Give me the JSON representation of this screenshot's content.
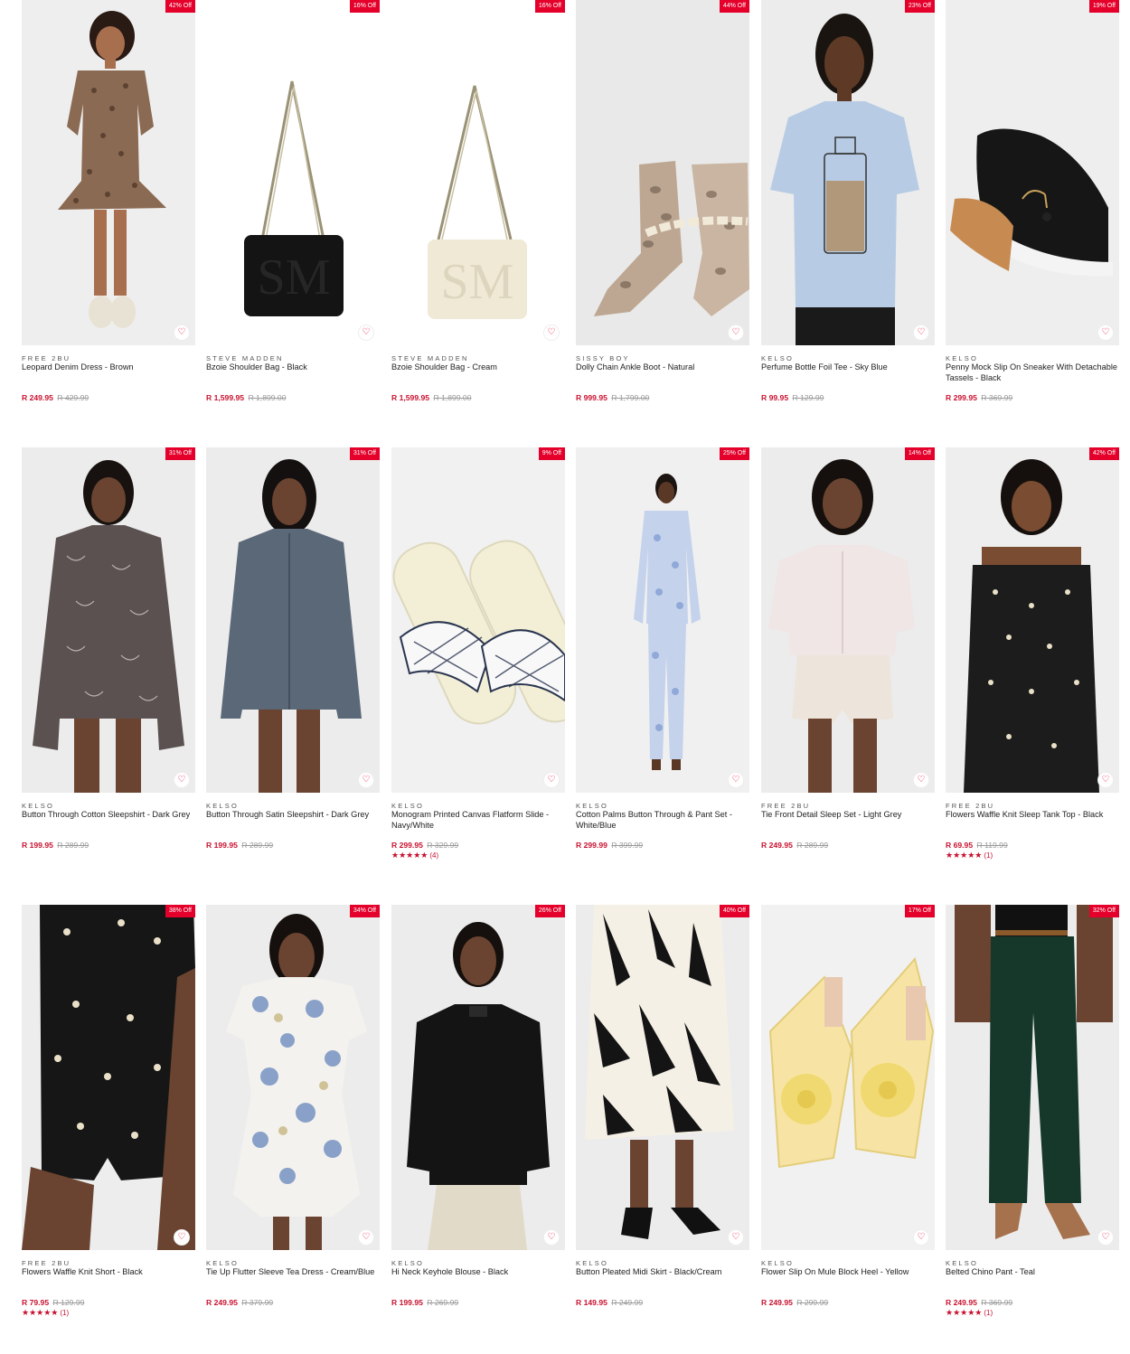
{
  "wishlist_icon": "heart-outline-icon",
  "colors": {
    "badge": "#e4002b",
    "sale_price": "#c8102e",
    "was_price": "#999999"
  },
  "products": [
    {
      "badge": "42% Off",
      "brand": "FREE 2BU",
      "name": "Leopard Denim Dress - Brown",
      "price": "R 249.95",
      "was": "R 429.99"
    },
    {
      "badge": "16% Off",
      "brand": "STEVE MADDEN",
      "name": "Bzoie Shoulder Bag - Black",
      "price": "R 1,599.95",
      "was": "R 1,899.00"
    },
    {
      "badge": "16% Off",
      "brand": "STEVE MADDEN",
      "name": "Bzoie Shoulder Bag - Cream",
      "price": "R 1,599.95",
      "was": "R 1,899.00"
    },
    {
      "badge": "44% Off",
      "brand": "SISSY BOY",
      "name": "Dolly Chain Ankle Boot - Natural",
      "price": "R 999.95",
      "was": "R 1,799.00"
    },
    {
      "badge": "23% Off",
      "brand": "KELSO",
      "name": "Perfume Bottle Foil Tee - Sky Blue",
      "price": "R 99.95",
      "was": "R 129.99"
    },
    {
      "badge": "19% Off",
      "brand": "KELSO",
      "name": "Penny Mock Slip On Sneaker With Detachable Tassels - Black",
      "price": "R 299.95",
      "was": "R 369.99"
    },
    {
      "badge": "31% Off",
      "brand": "KELSO",
      "name": "Button Through Cotton Sleepshirt - Dark Grey",
      "price": "R 199.95",
      "was": "R 289.99"
    },
    {
      "badge": "31% Off",
      "brand": "KELSO",
      "name": "Button Through Satin Sleepshirt - Dark Grey",
      "price": "R 199.95",
      "was": "R 289.99"
    },
    {
      "badge": "9% Off",
      "brand": "KELSO",
      "name": "Monogram Printed Canvas Flatform Slide - Navy/White",
      "price": "R 299.95",
      "was": "R 329.99",
      "stars": "★★★★★",
      "count": "(4)"
    },
    {
      "badge": "25% Off",
      "brand": "KELSO",
      "name": "Cotton Palms Button Through & Pant Set - White/Blue",
      "price": "R 299.99",
      "was": "R 399.99"
    },
    {
      "badge": "14% Off",
      "brand": "FREE 2BU",
      "name": "Tie Front Detail Sleep Set - Light Grey",
      "price": "R 249.95",
      "was": "R 289.99"
    },
    {
      "badge": "42% Off",
      "brand": "FREE 2BU",
      "name": "Flowers Waffle Knit Sleep Tank Top - Black",
      "price": "R 69.95",
      "was": "R 119.99",
      "stars": "★★★★★",
      "count": "(1)"
    },
    {
      "badge": "38% Off",
      "brand": "FREE 2BU",
      "name": "Flowers Waffle Knit Short - Black",
      "price": "R 79.95",
      "was": "R 129.99",
      "stars": "★★★★★",
      "count": "(1)"
    },
    {
      "badge": "34% Off",
      "brand": "KELSO",
      "name": "Tie Up Flutter Sleeve Tea Dress - Cream/Blue",
      "price": "R 249.95",
      "was": "R 379.99"
    },
    {
      "badge": "26% Off",
      "brand": "KELSO",
      "name": "Hi Neck Keyhole Blouse - Black",
      "price": "R 199.95",
      "was": "R 269.99"
    },
    {
      "badge": "40% Off",
      "brand": "KELSO",
      "name": "Button Pleated Midi Skirt - Black/Cream",
      "price": "R 149.95",
      "was": "R 249.99"
    },
    {
      "badge": "17% Off",
      "brand": "KELSO",
      "name": "Flower Slip On Mule Block Heel - Yellow",
      "price": "R 249.95",
      "was": "R 299.99"
    },
    {
      "badge": "32% Off",
      "brand": "KELSO",
      "name": "Belted Chino Pant - Teal",
      "price": "R 249.95",
      "was": "R 369.99",
      "stars": "★★★★★",
      "count": "(1)"
    }
  ]
}
